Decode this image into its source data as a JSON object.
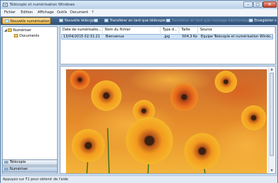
{
  "window": {
    "title": "Télécopie et numérisation Windows"
  },
  "menu": [
    "Fichier",
    "Edition",
    "Affichage",
    "Outils",
    "Document",
    "?"
  ],
  "toolbar": {
    "new_scan": "Nouvelle numérisation",
    "new_fax": "Nouvelle télécopie",
    "forward_fax": "Transférer en tant que télécopie",
    "forward_email": "Transférer en tant que message électronique",
    "save_as": "Enregistrer s"
  },
  "sidebar": {
    "root": "Numériser",
    "child": "Documents",
    "nav_fax": "Télécopie",
    "nav_scan": "Numériser"
  },
  "list": {
    "columns": [
      "Date de numérisatio...",
      "Nom du fichier",
      "Type d...",
      "Taille",
      "Source"
    ],
    "rows": [
      [
        "13/04/2015 02:31:21",
        "Bienvenue",
        ".jpg",
        "504,3 Ko",
        "Équipe Télécopie et numérisation Windo..."
      ]
    ]
  },
  "preview": {
    "image": "orange-flowers-photo"
  },
  "status": "Appuyez sur F1 pour obtenir de l'aide",
  "colors": {
    "toolbar": "#2f5178",
    "selection": "#cfe3f7",
    "active_button": "#f0b94a"
  }
}
